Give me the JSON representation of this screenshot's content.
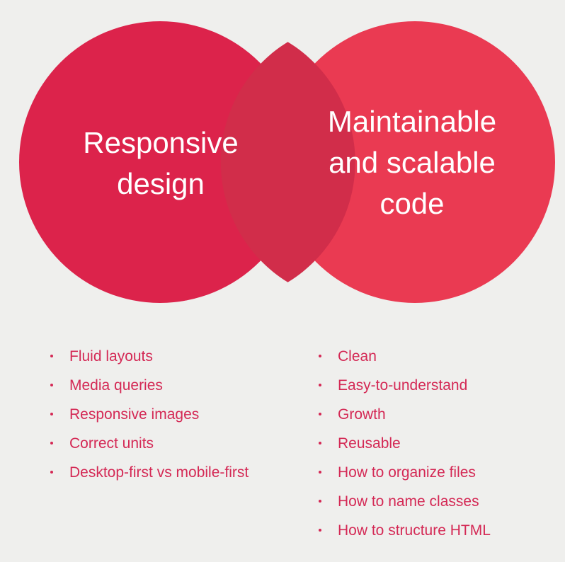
{
  "colors": {
    "background": "#efefed",
    "left_circle": "#dc234b",
    "right_circle": "#ea3a52",
    "overlap": "#d12d4a",
    "bullet_text": "#d42955",
    "circle_text": "#ffffff"
  },
  "venn": {
    "left": {
      "title": "Responsive\ndesign",
      "items": [
        "Fluid layouts",
        "Media queries",
        "Responsive images",
        "Correct units",
        "Desktop-first vs mobile-first"
      ]
    },
    "right": {
      "title": "Maintainable\nand scalable\ncode",
      "items": [
        "Clean",
        "Easy-to-understand",
        "Growth",
        "Reusable",
        "How to organize files",
        "How to name classes",
        "How to structure HTML"
      ]
    }
  }
}
